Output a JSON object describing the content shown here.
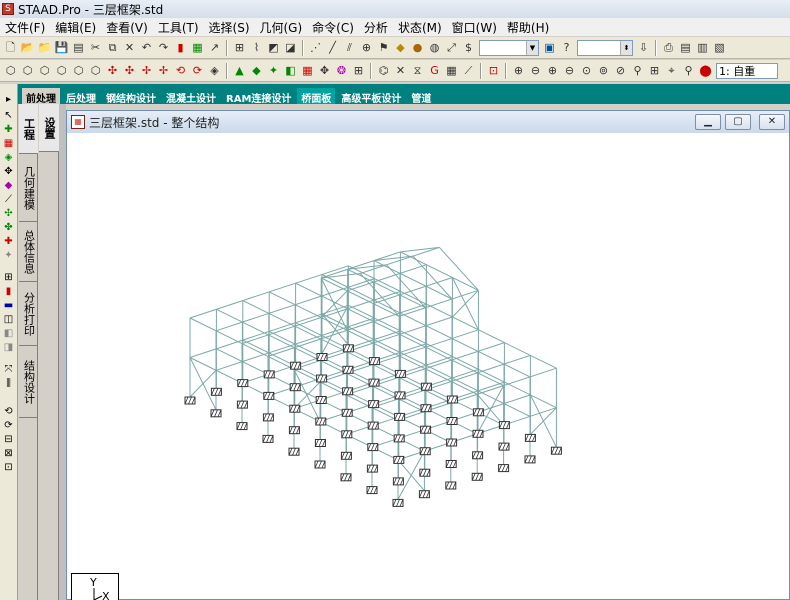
{
  "app": {
    "title": "STAAD.Pro - 三层框架.std"
  },
  "menu": {
    "items": [
      "文件(F)",
      "编辑(E)",
      "查看(V)",
      "工具(T)",
      "选择(S)",
      "几何(G)",
      "命令(C)",
      "分析",
      "状态(M)",
      "窗口(W)",
      "帮助(H)"
    ]
  },
  "toolbar": {
    "load_case": "1: 自重"
  },
  "mode_tabs": {
    "items": [
      "前处理",
      "后处理",
      "钢结构设计",
      "混凝土设计",
      "RAM连接设计",
      "桥面板",
      "高级平板设计",
      "管道"
    ]
  },
  "side_tabs": {
    "items": [
      "工程",
      "几何建模",
      "总体信息",
      "分析打印",
      "结构设计"
    ]
  },
  "tree_strip": {
    "label": "设置"
  },
  "document": {
    "title": "三层框架.std - 整个结构"
  },
  "axis": {
    "y_label": "Y",
    "x_label": "X"
  },
  "colors": {
    "tab_bar": "#00807e",
    "structure_line": "#7ca8a8",
    "support": "#333333"
  }
}
